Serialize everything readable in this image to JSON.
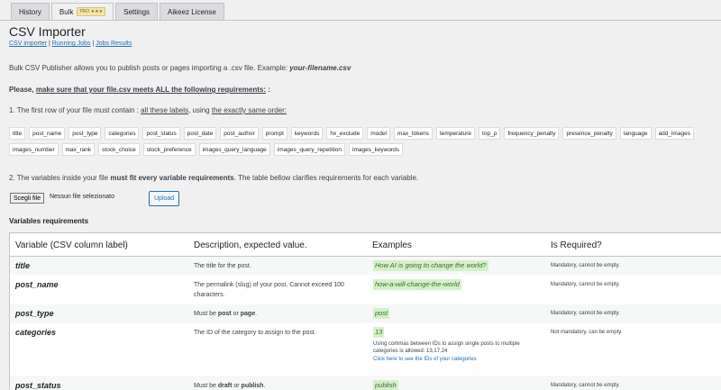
{
  "tabs": [
    {
      "label": "History"
    },
    {
      "label": "Bulk",
      "badge": "PRO ★★★"
    },
    {
      "label": "Settings"
    },
    {
      "label": "Aikeez License"
    }
  ],
  "page": {
    "title": "CSV Importer",
    "sublinks": [
      "CSV importer",
      "Running Jobs",
      "Jobs Results"
    ],
    "sep": " | "
  },
  "intro": {
    "text": "Bulk CSV Publisher allows you to publish posts or pages importing a .csv file. Example: ",
    "example": "your-filename.csv"
  },
  "please": {
    "prefix": "Please, ",
    "link": "make sure that your file.csv meets ALL the following requirements:",
    "suffix": " :"
  },
  "step1": {
    "text": "1. The first row of your file must contain : ",
    "link1": "all these labels",
    "mid": ", using ",
    "link2": "the exactly same order:"
  },
  "labels": [
    "title",
    "post_name",
    "post_type",
    "categories",
    "post_status",
    "post_date",
    "post_author",
    "prompt",
    "keywords",
    "hx_exclude",
    "model",
    "max_tokens",
    "temperature",
    "top_p",
    "frequency_penalty",
    "presence_penalty",
    "language",
    "add_images",
    "images_number",
    "max_rank",
    "stock_choice",
    "stock_preference",
    "images_query_language",
    "images_query_repetition",
    "images_keywords"
  ],
  "step2": {
    "text": "2. The variables inside your file ",
    "bold": "must fit every variable requirements",
    "rest": ". The table bellow clarifies requirements for each variable."
  },
  "upload": {
    "file_button": "Scegli file",
    "file_text": "Nessun file selezionato",
    "upload_button": "Upload"
  },
  "vars": {
    "title": "Variables requirements",
    "headers": [
      "Variable (CSV column label)",
      "Description, expected value.",
      "Examples",
      "Is Required?"
    ],
    "rows": [
      {
        "name": "title",
        "desc": "The title for the post.",
        "example": "How AI is going to change the world?",
        "req": "Mandatory, cannot be empty."
      },
      {
        "name": "post_name",
        "desc": "The permalink (slug) of your post. Cannot exceed 100 characters.",
        "example": "how-a-will-change-the-world",
        "req": "Mandatory, cannot be empty."
      },
      {
        "name": "post_type",
        "desc_pre": "Must be ",
        "desc_b1": "post",
        "desc_mid": " or ",
        "desc_b2": "page",
        "desc_end": ".",
        "example": "post",
        "req": "Mandatory, cannot be empty."
      },
      {
        "name": "categories",
        "desc": "The ID of the category to assign to the post.",
        "example": "13",
        "note": "Using commas between IDs to assign single posts to multiple categories is allowed: 13,17,24",
        "link": "Click here to see the IDs of your categories",
        "req": "Not mandatory, can be empty."
      },
      {
        "name": "post_status",
        "desc_pre": "Must be ",
        "desc_b1": "draft",
        "desc_mid": " or ",
        "desc_b2": "publish",
        "desc_end": ".",
        "example": "publish",
        "req": "Mandatory, cannot be empty."
      }
    ]
  }
}
